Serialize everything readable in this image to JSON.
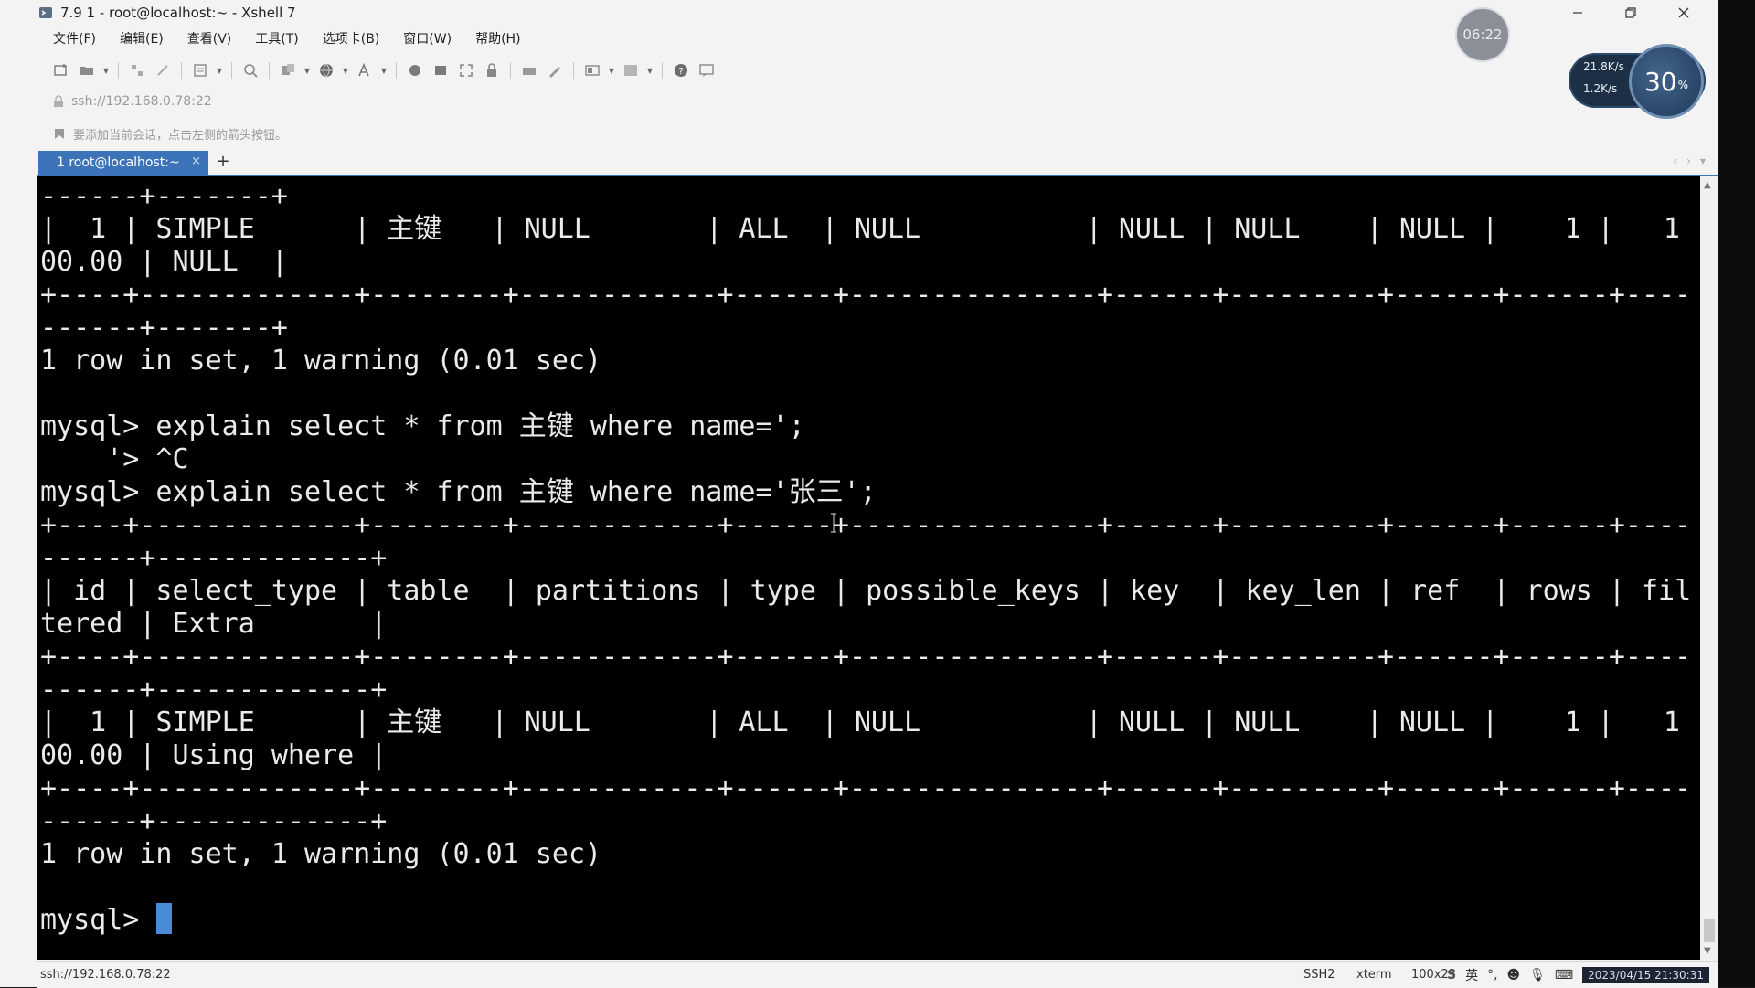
{
  "window": {
    "title": "7.9 1 - root@localhost:~ - Xshell 7"
  },
  "menu": [
    "文件(F)",
    "编辑(E)",
    "查看(V)",
    "工具(T)",
    "选项卡(B)",
    "窗口(W)",
    "帮助(H)"
  ],
  "address": "ssh://192.168.0.78:22",
  "hint": "要添加当前会话，点击左侧的箭头按钮。",
  "overlay": {
    "time": "06:22",
    "net_up": "21.8K/s",
    "net_down": "1.2K/s",
    "net_percent": "30",
    "net_percent_unit": "%"
  },
  "tab": {
    "label": "1 root@localhost:~",
    "close": "×",
    "add": "+"
  },
  "terminal": {
    "lines": [
      "------+-------+",
      "|  1 | SIMPLE      | 主键   | NULL       | ALL  | NULL          | NULL | NULL    | NULL |    1 |   1",
      "00.00 | NULL  |",
      "+----+-------------+--------+------------+------+---------------+------+---------+------+------+----",
      "------+-------+",
      "1 row in set, 1 warning (0.01 sec)",
      "",
      "mysql> explain select * from 主键 where name=';",
      "    '> ^C",
      "mysql> explain select * from 主键 where name='张三';",
      "+----+-------------+--------+------------+------+---------------+------+---------+------+------+----",
      "------+-------------+",
      "| id | select_type | table  | partitions | type | possible_keys | key  | key_len | ref  | rows | fil",
      "tered | Extra       |",
      "+----+-------------+--------+------------+------+---------------+------+---------+------+------+----",
      "------+-------------+",
      "|  1 | SIMPLE      | 主键   | NULL       | ALL  | NULL          | NULL | NULL    | NULL |    1 |   1",
      "00.00 | Using where |",
      "+----+-------------+--------+------------+------+---------------+------+---------+------+------+----",
      "------+-------------+",
      "1 row in set, 1 warning (0.01 sec)",
      "",
      "mysql> "
    ]
  },
  "status": {
    "left": "ssh://192.168.0.78:22",
    "protocol": "SSH2",
    "term": "xterm",
    "size": "100x23",
    "ime": "英",
    "clock": "2023/04/15 21:30:31"
  }
}
